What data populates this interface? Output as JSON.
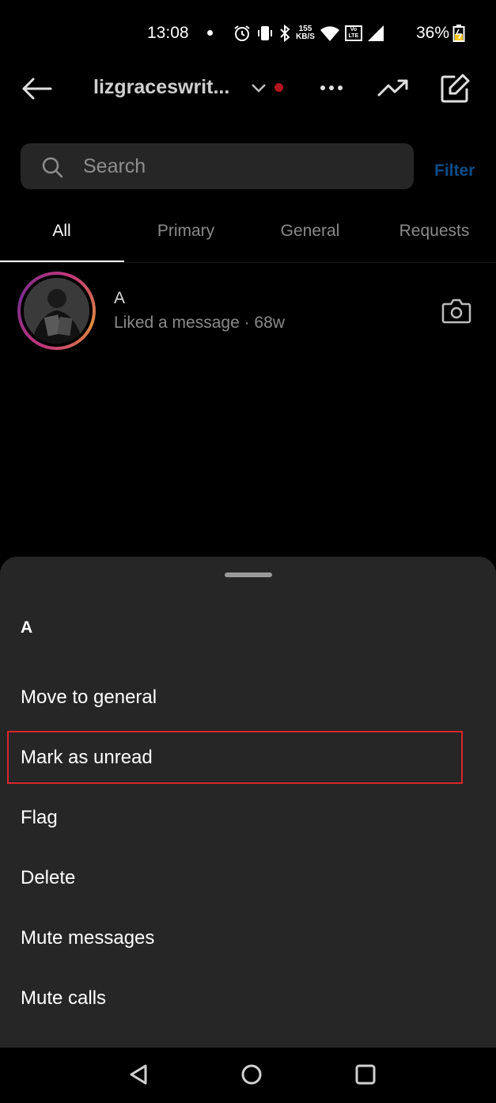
{
  "status_bar": {
    "time": "13:08",
    "net_speed_top": "155",
    "net_speed_bottom": "KB/S",
    "volte": "Vo LTE",
    "battery": "36%"
  },
  "header": {
    "username": "lizgraceswrit...",
    "icons": [
      "back-arrow-icon",
      "chevron-down-icon",
      "more-icon",
      "trending-icon",
      "compose-icon"
    ],
    "notification_dot_color": "#b3161f"
  },
  "search": {
    "placeholder": "Search",
    "filter_label": "Filter"
  },
  "tabs": [
    {
      "label": "All",
      "active": true
    },
    {
      "label": "Primary",
      "active": false
    },
    {
      "label": "General",
      "active": false
    },
    {
      "label": "Requests",
      "active": false
    }
  ],
  "thread": {
    "name": "A",
    "subtitle": "Liked a message · 68w"
  },
  "sheet": {
    "title": "A",
    "items": [
      {
        "label": "Move to general"
      },
      {
        "label": "Mark as unread",
        "highlighted": true
      },
      {
        "label": "Flag"
      },
      {
        "label": "Delete"
      },
      {
        "label": "Mute messages"
      },
      {
        "label": "Mute calls"
      }
    ],
    "highlight_color": "#d7262c"
  },
  "nav": {
    "icons": [
      "back-triangle-icon",
      "home-circle-icon",
      "recents-square-icon"
    ]
  }
}
